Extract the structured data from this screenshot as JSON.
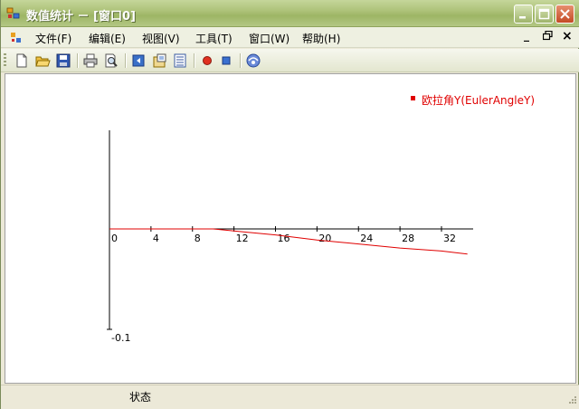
{
  "window": {
    "title": "数值统计 － [窗口0]",
    "accent_color": "#9db565"
  },
  "menu": {
    "items": [
      {
        "label": "文件(F)"
      },
      {
        "label": "编辑(E)"
      },
      {
        "label": "视图(V)"
      },
      {
        "label": "工具(T)"
      },
      {
        "label": "窗口(W)"
      },
      {
        "label": "帮助(H)"
      }
    ],
    "mdi_minimize": "_",
    "mdi_restore": "🗗",
    "mdi_close": "×"
  },
  "toolbar": {
    "buttons": [
      "new-file-icon",
      "open-folder-icon",
      "save-icon",
      "print-icon",
      "print-preview-icon",
      "back-icon",
      "properties-icon",
      "list-icon",
      "record-icon",
      "stop-icon",
      "help-icon"
    ]
  },
  "chart_data": {
    "type": "line",
    "x_ticks": [
      "0",
      "4",
      "8",
      "12",
      "16",
      "20",
      "24",
      "28",
      "32"
    ],
    "x_tick_values": [
      0,
      4,
      8,
      12,
      16,
      20,
      24,
      28,
      32
    ],
    "xlim": [
      0,
      34.5
    ],
    "ylim": [
      -0.1,
      0.1
    ],
    "y_labels": [
      "-0.1"
    ],
    "grid": false,
    "legend_position": "top-right",
    "series": [
      {
        "name": "欧拉角Y(EulerAngleY)",
        "color": "#e00000",
        "x": [
          0,
          4,
          8,
          10,
          12,
          16,
          20,
          24,
          28,
          32,
          34.5
        ],
        "y": [
          0,
          0,
          0,
          0,
          -0.002,
          -0.006,
          -0.011,
          -0.015,
          -0.019,
          -0.022,
          -0.025
        ]
      }
    ]
  },
  "status": {
    "label": "状态"
  }
}
